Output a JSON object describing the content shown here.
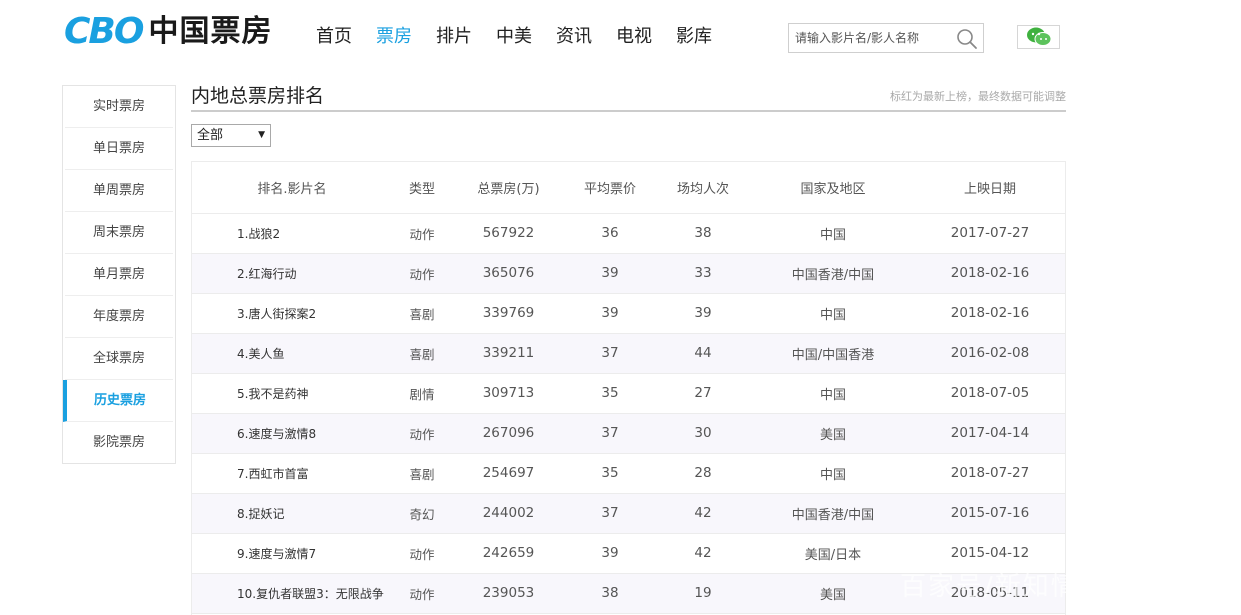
{
  "logo": {
    "mark": "CBO",
    "name": "中国票房"
  },
  "nav": [
    {
      "label": "首页",
      "active": false
    },
    {
      "label": "票房",
      "active": true
    },
    {
      "label": "排片",
      "active": false
    },
    {
      "label": "中美",
      "active": false
    },
    {
      "label": "资讯",
      "active": false
    },
    {
      "label": "电视",
      "active": false
    },
    {
      "label": "影库",
      "active": false
    }
  ],
  "search": {
    "placeholder": "请输入影片名/影人名称",
    "value": ""
  },
  "sidebar": [
    {
      "label": "实时票房",
      "active": false
    },
    {
      "label": "单日票房",
      "active": false
    },
    {
      "label": "单周票房",
      "active": false
    },
    {
      "label": "周末票房",
      "active": false
    },
    {
      "label": "单月票房",
      "active": false
    },
    {
      "label": "年度票房",
      "active": false
    },
    {
      "label": "全球票房",
      "active": false
    },
    {
      "label": "历史票房",
      "active": true
    },
    {
      "label": "影院票房",
      "active": false
    }
  ],
  "main": {
    "title": "内地总票房排名",
    "note": "标红为最新上榜，最终数据可能调整",
    "filter": {
      "selected": "全部"
    }
  },
  "table": {
    "columns": [
      "排名.影片名",
      "类型",
      "总票房(万)",
      "平均票价",
      "场均人次",
      "国家及地区",
      "上映日期"
    ],
    "rows": [
      [
        "1.战狼2",
        "动作",
        "567922",
        "36",
        "38",
        "中国",
        "2017-07-27"
      ],
      [
        "2.红海行动",
        "动作",
        "365076",
        "39",
        "33",
        "中国香港/中国",
        "2018-02-16"
      ],
      [
        "3.唐人街探案2",
        "喜剧",
        "339769",
        "39",
        "39",
        "中国",
        "2018-02-16"
      ],
      [
        "4.美人鱼",
        "喜剧",
        "339211",
        "37",
        "44",
        "中国/中国香港",
        "2016-02-08"
      ],
      [
        "5.我不是药神",
        "剧情",
        "309713",
        "35",
        "27",
        "中国",
        "2018-07-05"
      ],
      [
        "6.速度与激情8",
        "动作",
        "267096",
        "37",
        "30",
        "美国",
        "2017-04-14"
      ],
      [
        "7.西虹市首富",
        "喜剧",
        "254697",
        "35",
        "28",
        "中国",
        "2018-07-27"
      ],
      [
        "8.捉妖记",
        "奇幻",
        "244002",
        "37",
        "42",
        "中国香港/中国",
        "2015-07-16"
      ],
      [
        "9.速度与激情7",
        "动作",
        "242659",
        "39",
        "42",
        "美国/日本",
        "2015-04-12"
      ],
      [
        "10.复仇者联盟3：无限战争",
        "动作",
        "239053",
        "38",
        "19",
        "美国",
        "2018-05-11"
      ]
    ]
  },
  "watermark": "百家号/新知情报"
}
